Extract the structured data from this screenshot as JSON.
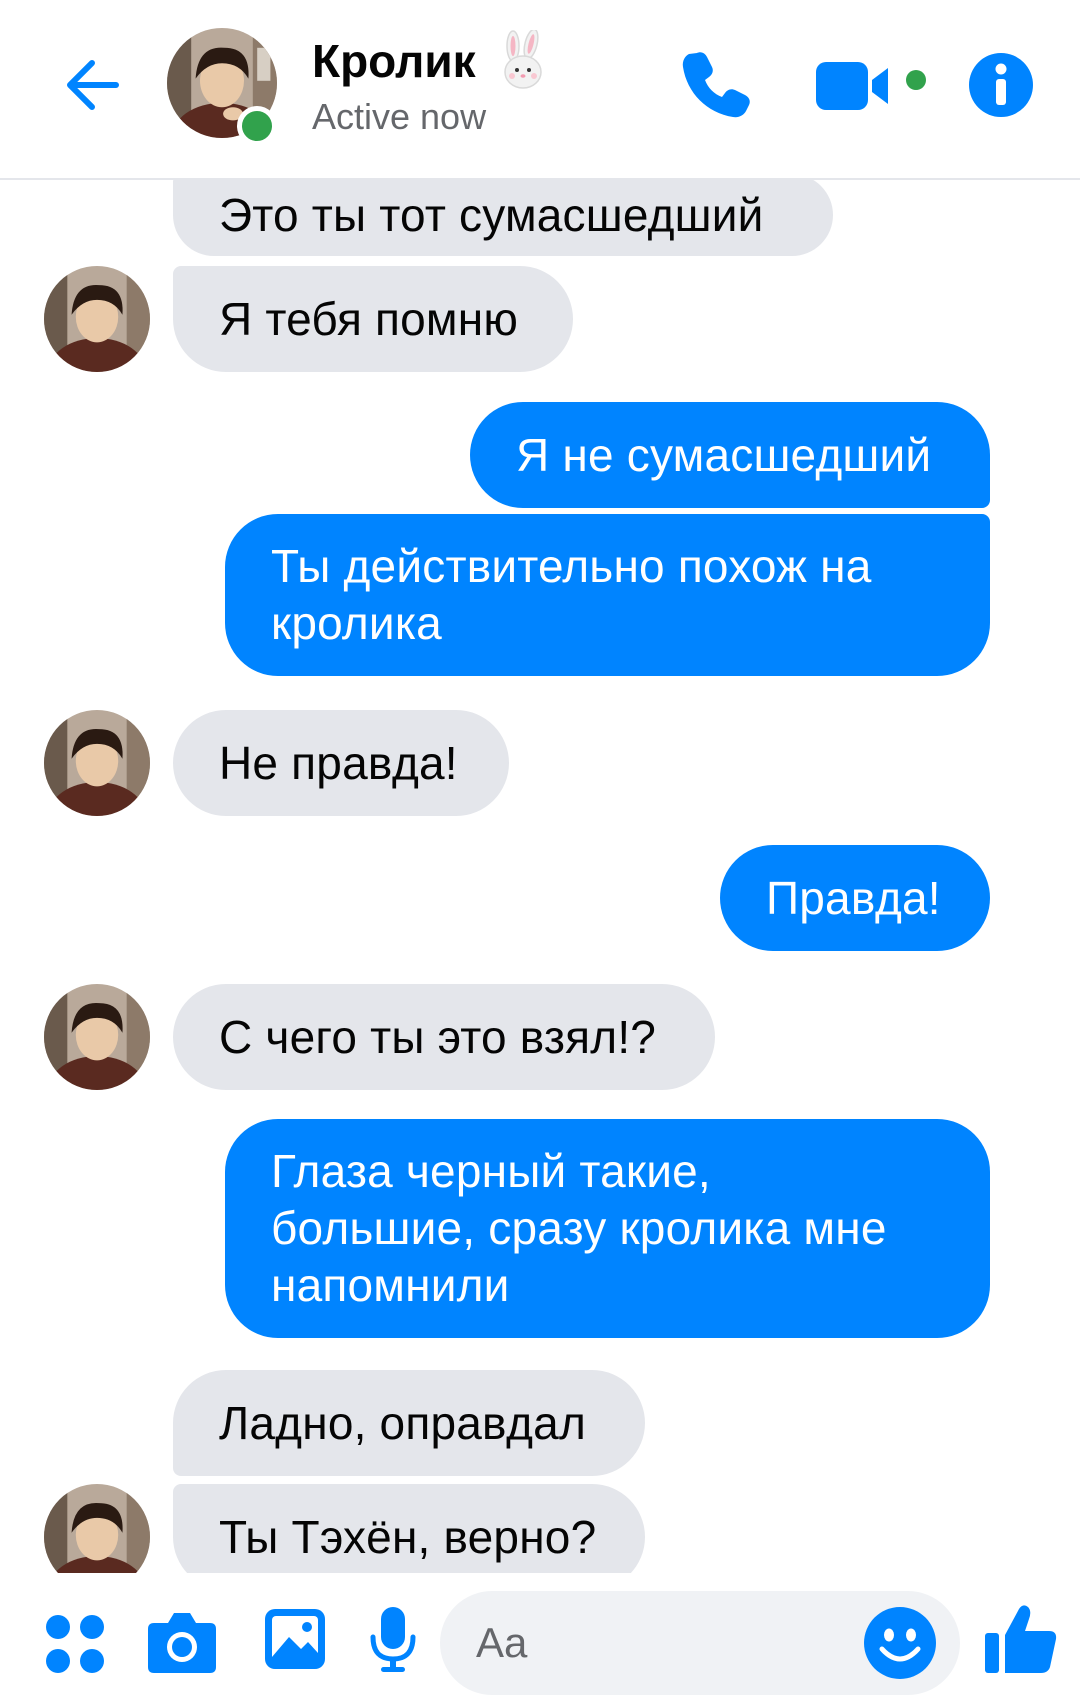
{
  "header": {
    "contact_name": "Кролик",
    "contact_emoji": "rabbit-emoji",
    "status": "Active now",
    "icons": [
      "back-arrow-icon",
      "phone-icon",
      "video-camera-icon",
      "info-icon"
    ]
  },
  "messages": [
    {
      "direction": "incoming",
      "text": "Это ты тот сумасшедший",
      "avatar": false
    },
    {
      "direction": "incoming",
      "text": "Я тебя помню",
      "avatar": true
    },
    {
      "direction": "outgoing",
      "text": "Я не сумасшедший"
    },
    {
      "direction": "outgoing",
      "text": "Ты действительно похож на\nкролика"
    },
    {
      "direction": "incoming",
      "text": "Не правда!",
      "avatar": true
    },
    {
      "direction": "outgoing",
      "text": "Правда!"
    },
    {
      "direction": "incoming",
      "text": "С чего ты это взял!?",
      "avatar": true
    },
    {
      "direction": "outgoing",
      "text": "Глаза черный такие,\nбольшие, сразу кролика мне\nнапомнили"
    },
    {
      "direction": "incoming",
      "text": "Ладно, оправдал",
      "avatar": false
    },
    {
      "direction": "incoming",
      "text": "Ты Тэхён, верно?",
      "avatar": true
    }
  ],
  "composer": {
    "placeholder": "Aa",
    "icons": [
      "apps-grid-icon",
      "camera-icon",
      "image-icon",
      "microphone-icon",
      "emoji-icon",
      "thumbs-up-icon"
    ]
  },
  "colors": {
    "accent": "#0084ff",
    "incoming_bubble": "#e4e6eb",
    "presence": "#31a24c"
  }
}
